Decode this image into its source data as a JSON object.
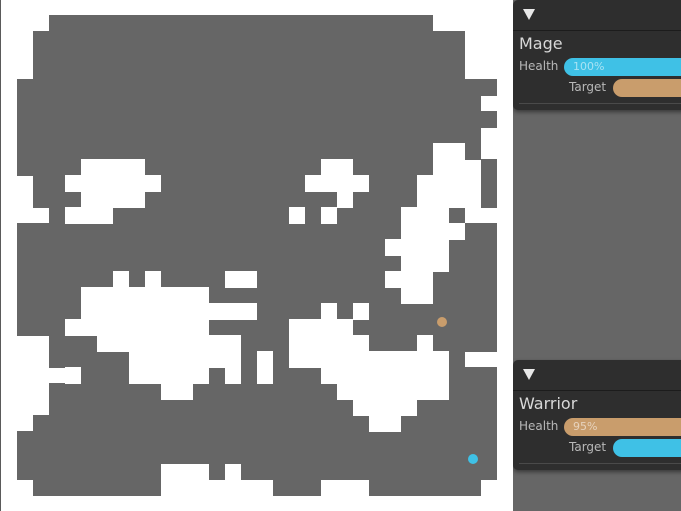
{
  "map": {
    "wall_color": "#666666",
    "floor_color": "#ffffff",
    "markers": [
      {
        "name": "warrior-marker",
        "color": "#c99d6c"
      },
      {
        "name": "mage-marker",
        "color": "#3fc1e6"
      }
    ]
  },
  "panels": [
    {
      "name": "Mage",
      "health_label": "Health",
      "health_text": "100%",
      "health_color": "#3fc1e6",
      "target_label": "Target",
      "target_color": "#c99d6c"
    },
    {
      "name": "Warrior",
      "health_label": "Health",
      "health_text": "95%",
      "health_color": "#c99d6c",
      "target_label": "Target",
      "target_color": "#3fc1e6"
    }
  ]
}
